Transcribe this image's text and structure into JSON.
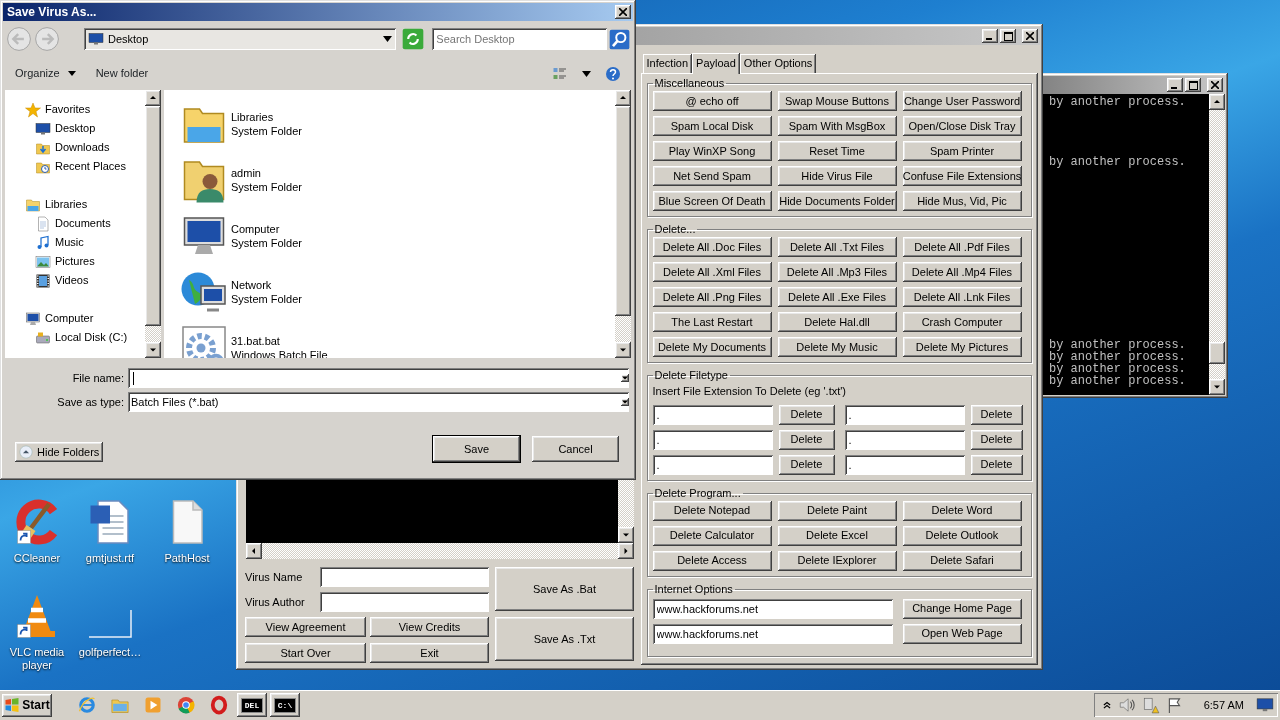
{
  "desktop": {
    "icons": [
      {
        "label": "CCleaner",
        "kind": "ccleaner",
        "shortcut": true
      },
      {
        "label": "gmtjust.rtf",
        "kind": "word",
        "shortcut": false
      },
      {
        "label": "PathHost",
        "kind": "blank",
        "shortcut": false
      },
      {
        "label": "VLC media player",
        "kind": "vlc",
        "shortcut": true
      },
      {
        "label": "golfperfect…",
        "kind": "outline",
        "shortcut": false
      }
    ]
  },
  "console": {
    "lines": [
      "by another process.",
      "by another process.",
      "by another process.",
      "by another process.",
      "by another process.",
      "by another process."
    ]
  },
  "app_window": {
    "tabs": [
      {
        "label": "Infection",
        "selected": false
      },
      {
        "label": "Payload",
        "selected": true
      },
      {
        "label": "Other Options",
        "selected": false
      }
    ],
    "groups": [
      {
        "title": "Miscellaneous",
        "kind": "buttons",
        "buttons": [
          "@ echo off",
          "Swap Mouse Buttons",
          "Change User Password",
          "Spam Local Disk",
          "Spam With MsgBox",
          "Open/Close Disk Tray",
          "Play WinXP Song",
          "Reset Time",
          "Spam Printer",
          "Net Send Spam",
          "Hide Virus File",
          "Confuse File Extensions",
          "Blue Screen Of Death",
          "Hide Documents Folder",
          "Hide Mus, Vid, Pic"
        ]
      },
      {
        "title": "Delete...",
        "kind": "buttons",
        "buttons": [
          "Delete All .Doc Files",
          "Delete All .Txt Files",
          "Delete All .Pdf Files",
          "Delete All .Xml Files",
          "Delete All .Mp3 Files",
          "Delete All .Mp4 Files",
          "Delete All .Png Files",
          "Delete All .Exe Files",
          "Delete All .Lnk Files",
          "The Last Restart",
          "Delete Hal.dll",
          "Crash Computer",
          "Delete My Documents",
          "Delete My Music",
          "Delete My Pictures"
        ]
      },
      {
        "title": "Delete Filetype",
        "kind": "extensions",
        "hint": "Insert File Extension To Delete (eg '.txt')",
        "fields": [
          {
            "value": ".",
            "button": "Delete"
          },
          {
            "value": ".",
            "button": "Delete"
          },
          {
            "value": ".",
            "button": "Delete"
          },
          {
            "value": ".",
            "button": "Delete"
          },
          {
            "value": ".",
            "button": "Delete"
          },
          {
            "value": ".",
            "button": "Delete"
          }
        ]
      },
      {
        "title": "Delete Program...",
        "kind": "buttons",
        "buttons": [
          "Delete Notepad",
          "Delete Paint",
          "Delete Word",
          "Delete Calculator",
          "Delete Excel",
          "Delete Outlook",
          "Delete Access",
          "Delete IExplorer",
          "Delete Safari"
        ]
      },
      {
        "title": "Internet Options",
        "kind": "urls",
        "fields": [
          {
            "value": "www.hackforums.net",
            "button": "Change Home Page"
          },
          {
            "value": "www.hackforums.net",
            "button": "Open Web Page"
          }
        ]
      }
    ],
    "virus_name_label": "Virus Name",
    "virus_author_label": "Virus Author",
    "actions": [
      "View Agreement",
      "View Credits",
      "Start Over",
      "Exit"
    ],
    "save_buttons": [
      "Save As .Bat",
      "Save As .Txt"
    ]
  },
  "save_dialog": {
    "title": "Save Virus As...",
    "location": "Desktop",
    "search_placeholder": "Search Desktop",
    "toolbar": [
      "Organize",
      "New folder"
    ],
    "nav": [
      {
        "label": "Favorites",
        "kind": "star",
        "children": [
          {
            "label": "Desktop",
            "kind": "desktop"
          },
          {
            "label": "Downloads",
            "kind": "downloads"
          },
          {
            "label": "Recent Places",
            "kind": "recent"
          }
        ]
      },
      {
        "label": "Libraries",
        "kind": "libraries",
        "children": [
          {
            "label": "Documents",
            "kind": "docs"
          },
          {
            "label": "Music",
            "kind": "music"
          },
          {
            "label": "Pictures",
            "kind": "pictures"
          },
          {
            "label": "Videos",
            "kind": "videos"
          }
        ]
      },
      {
        "label": "Computer",
        "kind": "computer",
        "children": [
          {
            "label": "Local Disk (C:)",
            "kind": "disk"
          }
        ]
      }
    ],
    "files": [
      {
        "name": "Libraries",
        "type": "System Folder",
        "kind": "libraries"
      },
      {
        "name": "admin",
        "type": "System Folder",
        "kind": "user"
      },
      {
        "name": "Computer",
        "type": "System Folder",
        "kind": "computer"
      },
      {
        "name": "Network",
        "type": "System Folder",
        "kind": "network"
      },
      {
        "name": "31.bat.bat",
        "type": "Windows Batch File",
        "kind": "batch"
      }
    ],
    "file_name_label": "File name:",
    "save_type_label": "Save as type:",
    "save_type": "Batch Files (*.bat)",
    "hide_folders": "Hide Folders",
    "buttons": [
      "Save",
      "Cancel"
    ]
  },
  "taskbar": {
    "start": "Start",
    "apps": [
      {
        "kind": "ie",
        "running": false
      },
      {
        "kind": "explorer",
        "running": false
      },
      {
        "kind": "media",
        "running": false
      },
      {
        "kind": "chrome",
        "running": false
      },
      {
        "kind": "opera",
        "running": false
      },
      {
        "kind": "del",
        "glyph": "DEL",
        "running": true
      },
      {
        "kind": "cmd",
        "glyph": "C:\\",
        "running": true
      }
    ],
    "clock": "6:57 AM"
  }
}
